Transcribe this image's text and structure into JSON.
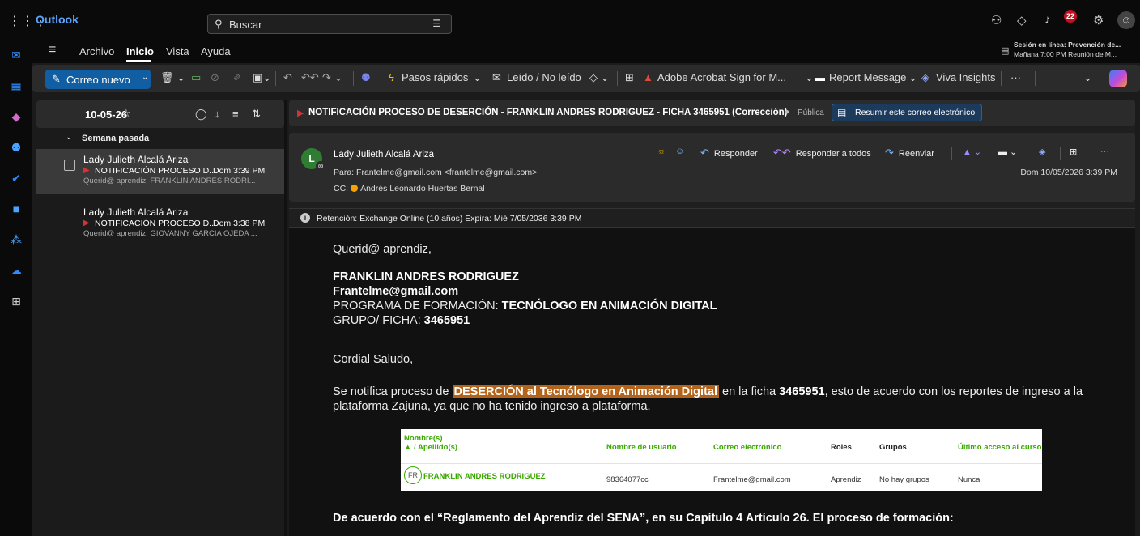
{
  "app": {
    "name": "Outlook"
  },
  "search": {
    "placeholder": "Buscar"
  },
  "topbar": {
    "notifications_count": "22"
  },
  "menu": {
    "tabs": [
      "Archivo",
      "Inicio",
      "Vista",
      "Ayuda"
    ],
    "active_tab": "Inicio"
  },
  "reminder": {
    "line1": "Sesión en línea: Prevención de...",
    "line2": "Mañana 7:00 PM Reunión de M..."
  },
  "ribbon": {
    "new_mail": "Correo nuevo",
    "quick_steps": "Pasos rápidos",
    "read_unread": "Leído / No leído",
    "adobe": "Adobe Acrobat Sign for M...",
    "report": "Report Message",
    "viva": "Viva Insights",
    "more": "···"
  },
  "list": {
    "folder_title": "10-05-26",
    "group_label": "Semana pasada",
    "messages": [
      {
        "sender": "Lady Julieth Alcalá Ariza",
        "subject": "NOTIFICACIÓN PROCESO D...",
        "date": "Dom 3:39 PM",
        "preview": "Querid@ aprendiz, FRANKLIN ANDRES RODRI..."
      },
      {
        "sender": "Lady Julieth Alcalá Ariza",
        "subject": "NOTIFICACIÓN PROCESO D...",
        "date": "Dom 3:38 PM",
        "preview": "Querid@ aprendiz, GIOVANNY GARCIA OJEDA ..."
      }
    ]
  },
  "email": {
    "subject": "NOTIFICACIÓN PROCESO DE DESERCIÓN - FRANKLIN ANDRES RODRIGUEZ  - FICHA 3465951 (Corrección)",
    "sensitivity": "Pública",
    "summarize_label": "Resumir este correo electrónico",
    "sender_initial": "L",
    "sender_name": "Lady Julieth Alcalá Ariza",
    "to_label": "Para:",
    "to_value": "Frantelme@gmail.com <frantelme@gmail.com>",
    "cc_label": "CC:",
    "cc_value": "Andrés Leonardo Huertas Bernal",
    "date": "Dom 10/05/2026 3:39 PM",
    "actions": {
      "reply": "Responder",
      "reply_all": "Responder a todos",
      "forward": "Reenviar"
    },
    "retention": "Retención: Exchange Online (10 años) Expira: Mié 7/05/2036 3:39 PM",
    "body": {
      "greeting": "Querid@ aprendiz,",
      "name": "FRANKLIN ANDRES RODRIGUEZ",
      "email": "Frantelme@gmail.com",
      "program_label": "PROGRAMA DE FORMACIÓN:",
      "program_value": "TECNÓLOGO EN ANIMACIÓN DIGITAL",
      "group_label": "GRUPO/ FICHA:",
      "group_value": "3465951",
      "cordial": "Cordial Saludo,",
      "p1_a": "Se notifica proceso de ",
      "p1_highlight": "DESERCIÓN al Tecnólogo en Animación Digital",
      "p1_b": " en la ficha ",
      "p1_ficha": "3465951",
      "p1_c": ", esto de acuerdo con los reportes de ingreso a la",
      "p1_line2": "plataforma Zajuna, ya que no ha tenido ingreso a plataforma.",
      "footer": "De acuerdo con el “Reglamento del Aprendiz del SENA”, en su Capítulo 4 Artículo 26. El proceso de formación:"
    },
    "table": {
      "headers": {
        "name_top": "Nombre(s)",
        "name_bottom": "/ Apellido(s)",
        "username": "Nombre de usuario",
        "email": "Correo electrónico",
        "roles": "Roles",
        "groups": "Grupos",
        "last_access": "Último acceso al curso"
      },
      "row": {
        "initials": "FR",
        "name": "FRANKLIN ANDRES RODRIGUEZ",
        "username": "98364077cc",
        "email": "Frantelme@gmail.com",
        "role": "Aprendiz",
        "groups": "No hay grupos",
        "last_access": "Nunca"
      }
    }
  }
}
